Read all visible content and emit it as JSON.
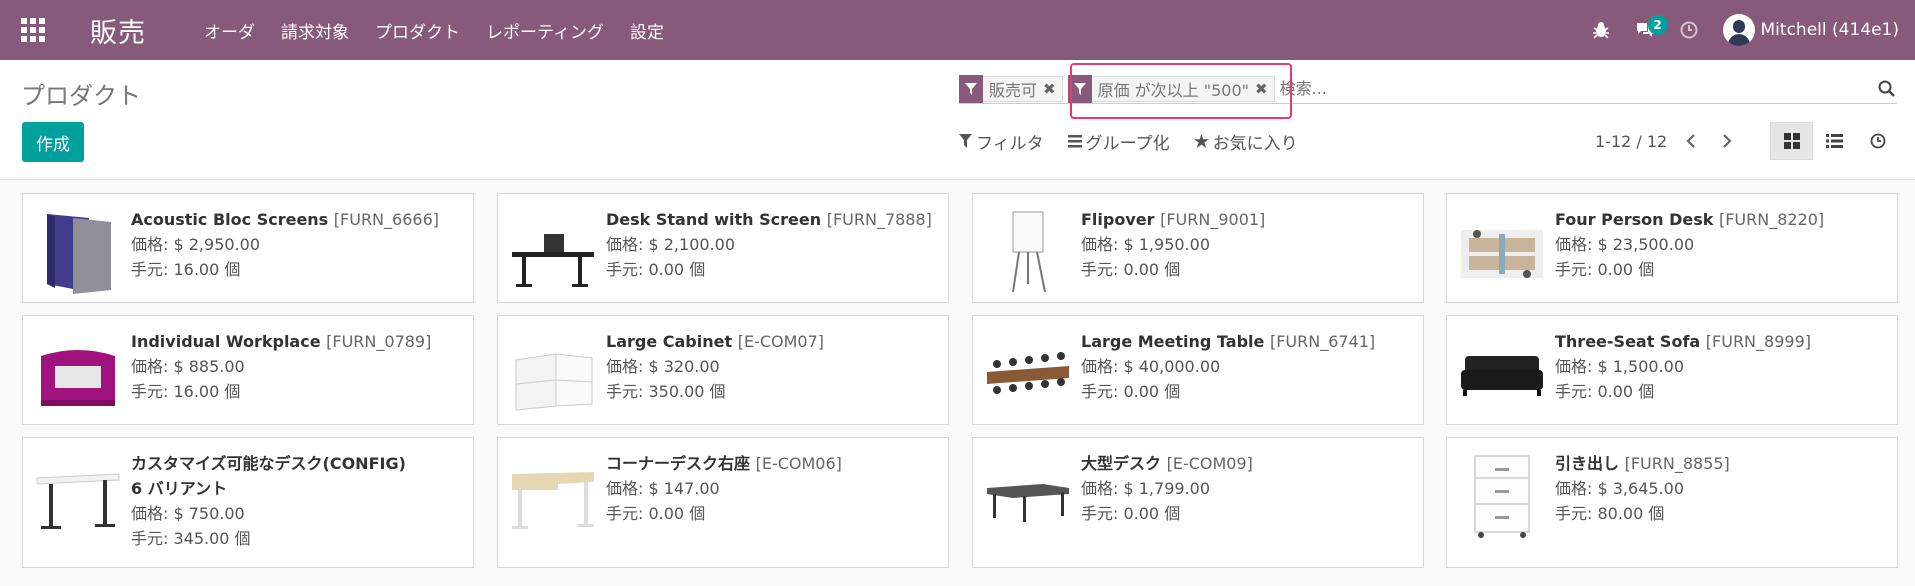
{
  "navbar": {
    "app_name": "販売",
    "menu": [
      "オーダ",
      "請求対象",
      "プロダクト",
      "レポーティング",
      "設定"
    ],
    "message_count": "2",
    "user_name": "Mitchell (414e1)",
    "accent_color": "#875a7b"
  },
  "control": {
    "page_title": "プロダクト",
    "create_label": "作成",
    "facets": [
      {
        "label": "販売可"
      },
      {
        "label": "原価 が次以上 \"500\""
      }
    ],
    "search_placeholder": "検索...",
    "filter_label": "フィルタ",
    "group_label": "グループ化",
    "favorites_label": "お気に入り",
    "pager_value": "1-12 / 12"
  },
  "products": [
    {
      "name": "Acoustic Bloc Screens",
      "code": "[FURN_6666]",
      "price": "価格: $ 2,950.00",
      "qty": "手元: 16.00 個",
      "icon": "acoustic-screens-image"
    },
    {
      "name": "Desk Stand with Screen",
      "code": "[FURN_7888]",
      "price": "価格: $ 2,100.00",
      "qty": "手元: 0.00 個",
      "icon": "desk-stand-image"
    },
    {
      "name": "Flipover",
      "code": "[FURN_9001]",
      "price": "価格: $ 1,950.00",
      "qty": "手元: 0.00 個",
      "icon": "flipover-image"
    },
    {
      "name": "Four Person Desk",
      "code": "[FURN_8220]",
      "price": "価格: $ 23,500.00",
      "qty": "手元: 0.00 個",
      "icon": "four-person-desk-image"
    },
    {
      "name": "Individual Workplace",
      "code": "[FURN_0789]",
      "price": "価格: $ 885.00",
      "qty": "手元: 16.00 個",
      "icon": "individual-workplace-image"
    },
    {
      "name": "Large Cabinet",
      "code": "[E-COM07]",
      "price": "価格: $ 320.00",
      "qty": "手元: 350.00 個",
      "icon": "large-cabinet-image"
    },
    {
      "name": "Large Meeting Table",
      "code": "[FURN_6741]",
      "price": "価格: $ 40,000.00",
      "qty": "手元: 0.00 個",
      "icon": "meeting-table-image"
    },
    {
      "name": "Three-Seat Sofa",
      "code": "[FURN_8999]",
      "price": "価格: $ 1,500.00",
      "qty": "手元: 0.00 個",
      "icon": "sofa-image"
    },
    {
      "name": "カスタマイズ可能なデスク(CONFIG)",
      "code": "",
      "variants": "6 バリアント",
      "price": "価格: $ 750.00",
      "qty": "手元: 345.00 個",
      "icon": "custom-desk-image"
    },
    {
      "name": "コーナーデスク右座",
      "code": "[E-COM06]",
      "price": "価格: $ 147.00",
      "qty": "手元: 0.00 個",
      "icon": "corner-desk-image"
    },
    {
      "name": "大型デスク",
      "code": "[E-COM09]",
      "price": "価格: $ 1,799.00",
      "qty": "手元: 0.00 個",
      "icon": "large-desk-image"
    },
    {
      "name": "引き出し",
      "code": "[FURN_8855]",
      "price": "価格: $ 3,645.00",
      "qty": "手元: 80.00 個",
      "icon": "drawer-image"
    }
  ]
}
